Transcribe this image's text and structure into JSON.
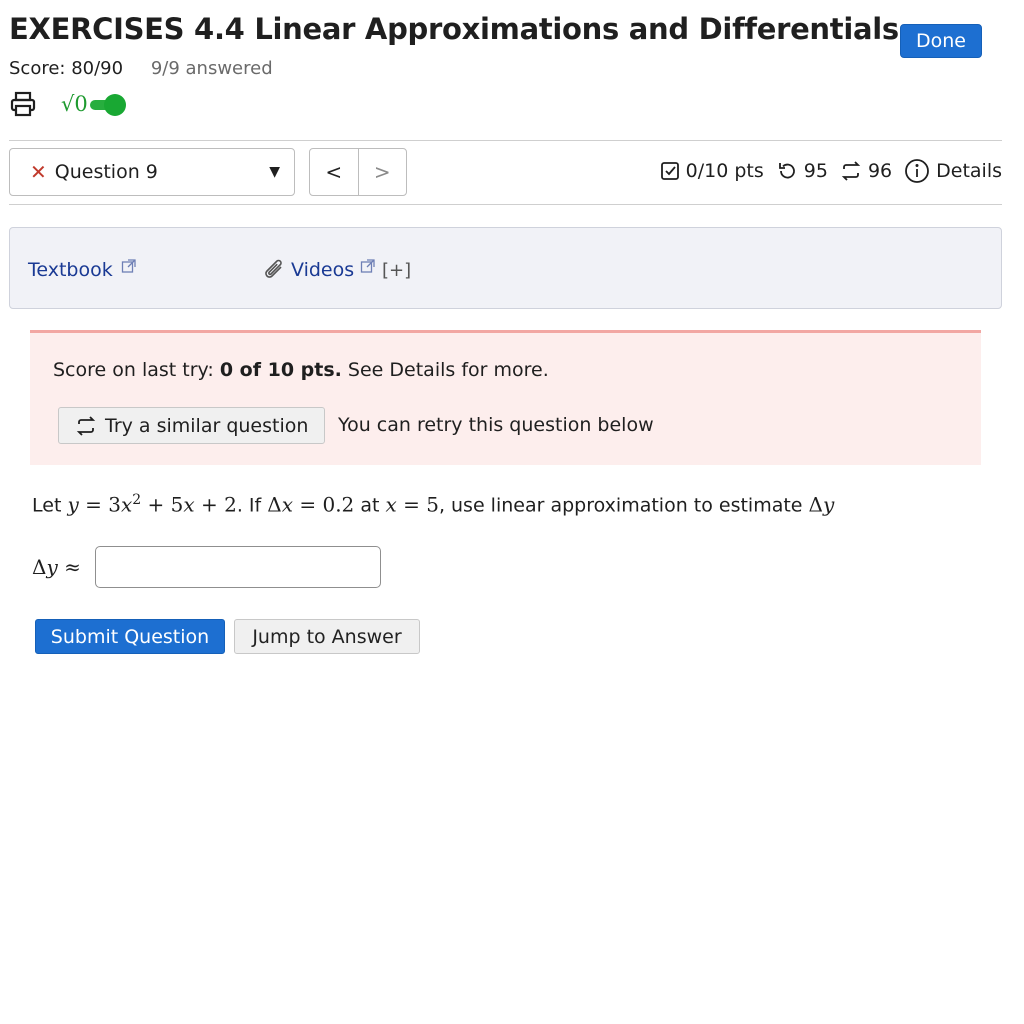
{
  "header": {
    "title": "EXERCISES 4.4 Linear Approximations and Differentials",
    "done_label": "Done",
    "score": "Score: 80/90",
    "answered": "9/9 answered",
    "sqrt_label": "√0"
  },
  "question_nav": {
    "current": "Question 9",
    "prev": "<",
    "next": ">"
  },
  "meta": {
    "points": "0/10 pts",
    "retries": "95",
    "similar": "96",
    "details": "Details"
  },
  "resources": {
    "textbook": "Textbook",
    "videos": "Videos",
    "expand": "[+]"
  },
  "alert": {
    "prefix": "Score on last try: ",
    "score": "0 of 10 pts.",
    "suffix": " See Details for more.",
    "similar_button": "Try a similar question",
    "retry_text": "You can retry this question below"
  },
  "question": {
    "let": "Let ",
    "y": "y",
    "eq1": " = 3",
    "x1": "x",
    "exp": "2",
    "plus1": " + 5",
    "x2": "x",
    "plus2": " + 2",
    "if": ". If ",
    "delta1": "Δ",
    "dx": "x",
    "eq2": " = 0.2",
    "at": " at ",
    "x3": "x",
    "eq3": " = 5",
    "rest": ", use linear approximation to estimate ",
    "delta2": "Δ",
    "y2": "y"
  },
  "answer": {
    "delta": "Δ",
    "y": "y",
    "approx": " ≈",
    "value": ""
  },
  "actions": {
    "submit": "Submit Question",
    "jump": "Jump to Answer"
  },
  "colors": {
    "primary": "#1d6fd1",
    "link": "#1a3a94",
    "alert_bg": "#fdeeed",
    "alert_border": "#f2a7a3",
    "toggle_green": "#19a833",
    "error_red": "#c0392b"
  }
}
